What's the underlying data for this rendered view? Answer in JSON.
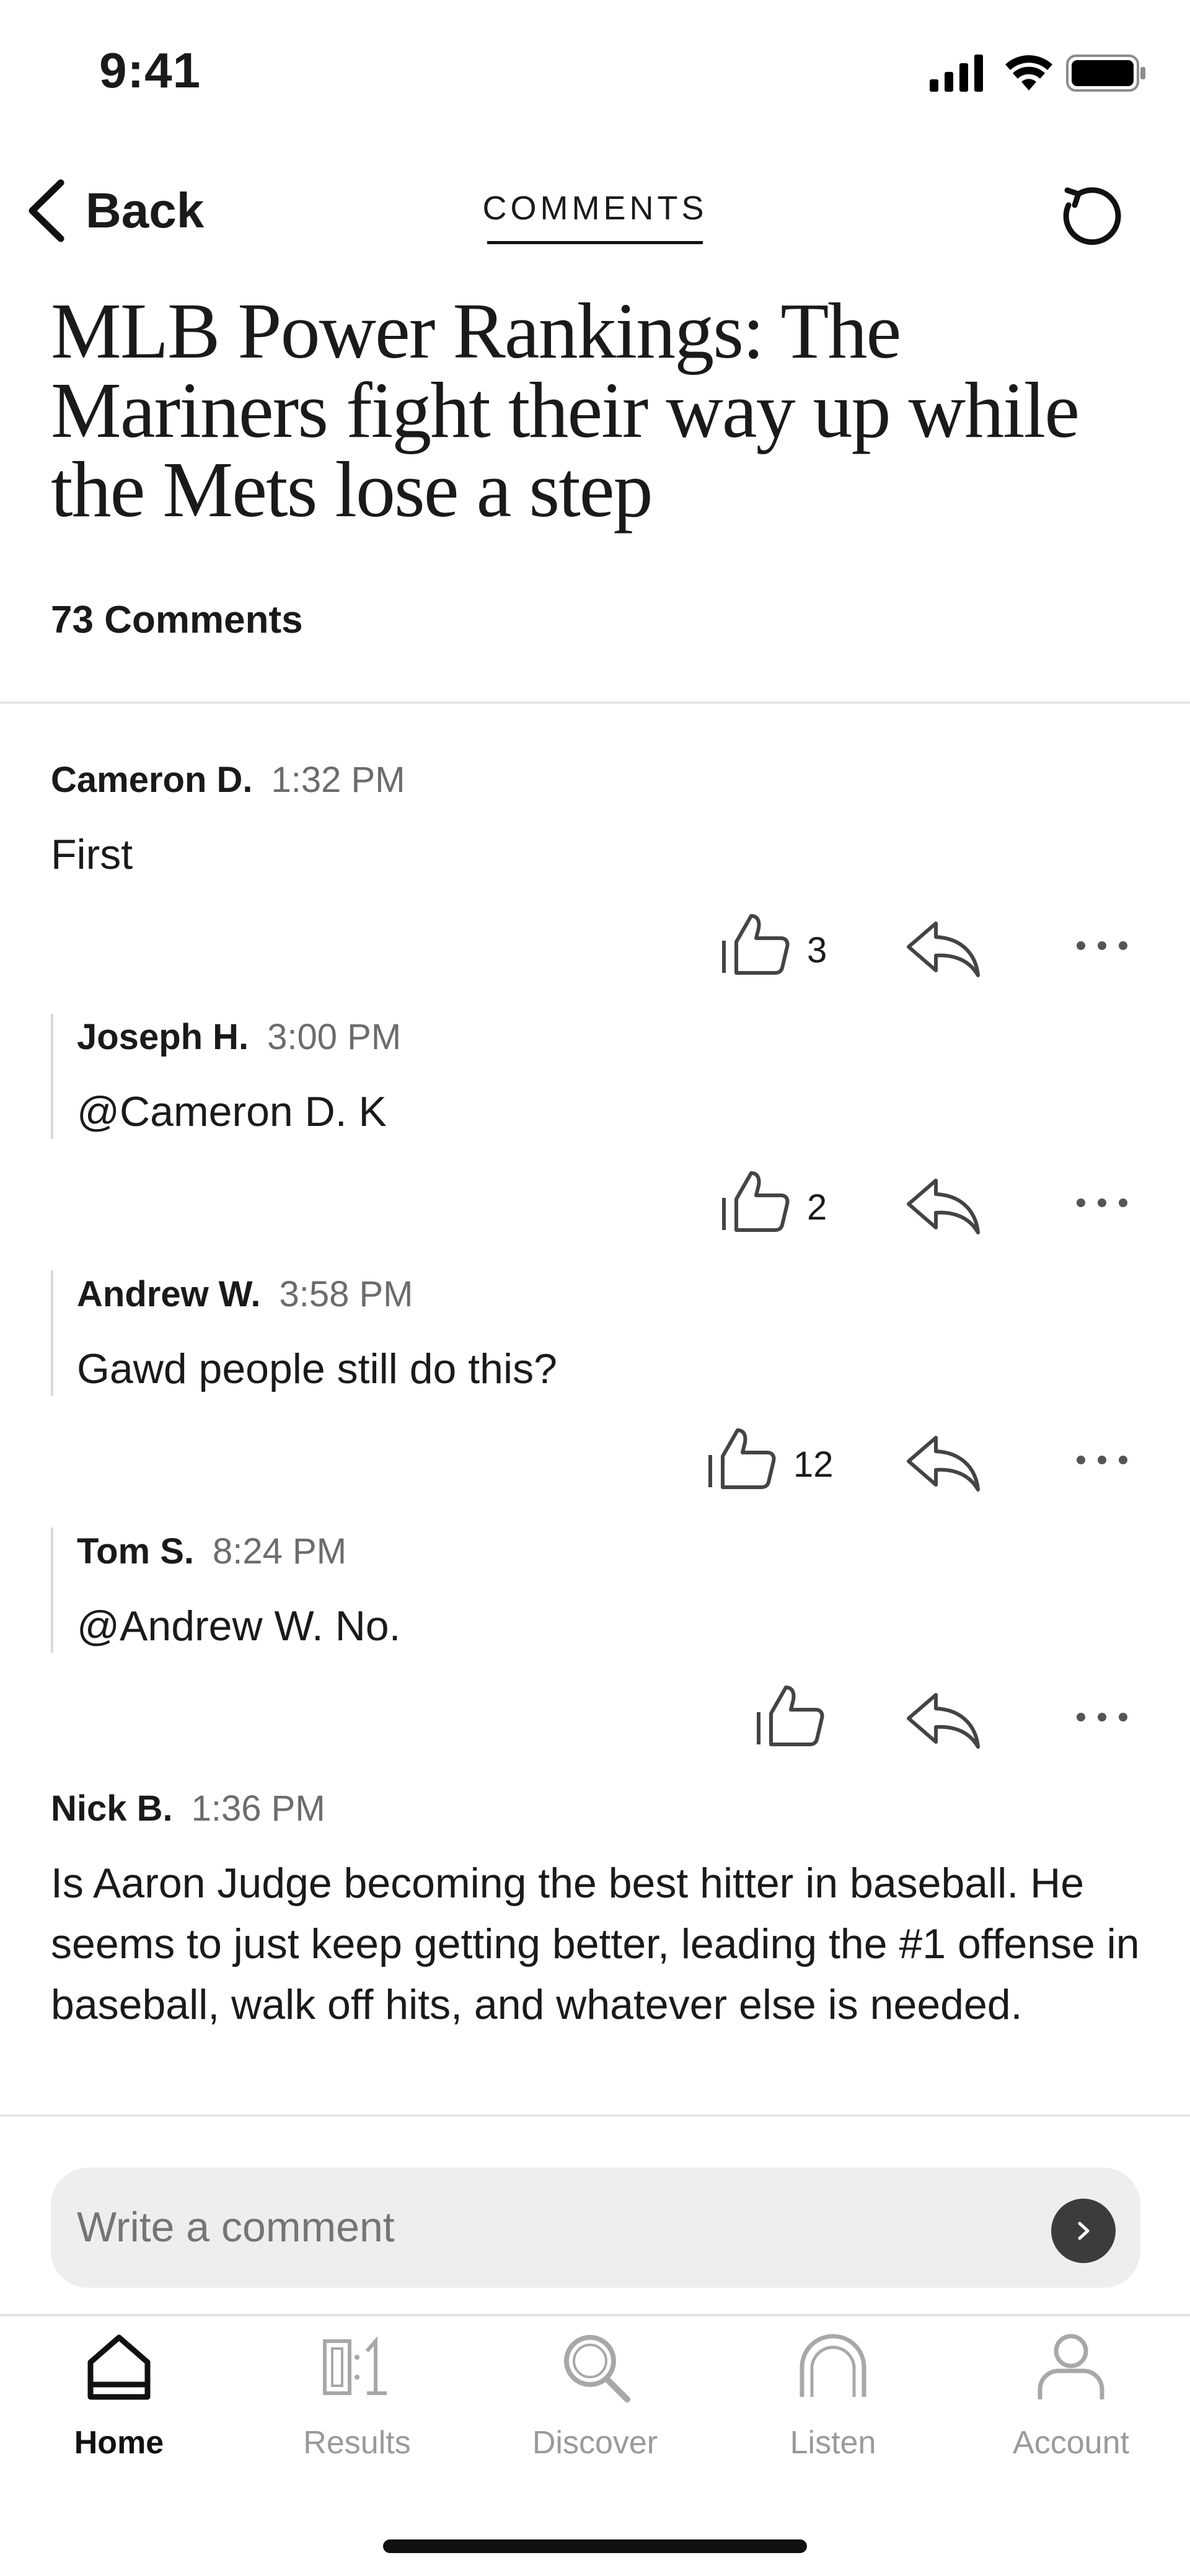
{
  "status_bar": {
    "time": "9:41"
  },
  "header": {
    "back_label": "Back",
    "tab_title": "COMMENTS"
  },
  "article": {
    "title": "MLB Power Rankings: The Mariners fight their way up while the Mets lose a step",
    "comment_count_label": "73 Comments"
  },
  "comments": [
    {
      "author": "Cameron D.",
      "time": "1:32 PM",
      "text": "First",
      "likes": "3",
      "is_reply": false
    },
    {
      "author": "Joseph H.",
      "time": "3:00 PM",
      "text": "@Cameron D. K",
      "likes": "2",
      "is_reply": true
    },
    {
      "author": "Andrew W.",
      "time": "3:58 PM",
      "text": "Gawd people still do this?",
      "likes": "12",
      "is_reply": true
    },
    {
      "author": "Tom S.",
      "time": "8:24 PM",
      "text": "@Andrew W. No.",
      "likes": "",
      "is_reply": true
    },
    {
      "author": "Nick B.",
      "time": "1:36 PM",
      "text": "Is Aaron Judge becoming the best hitter in baseball. He seems to just keep getting better, leading the #1 offense in baseball, walk off hits, and whatever else is needed.",
      "is_reply": false
    }
  ],
  "composer": {
    "placeholder": "Write a comment"
  },
  "tab_bar": {
    "items": [
      {
        "label": "Home",
        "icon": "home-icon",
        "active": true
      },
      {
        "label": "Results",
        "icon": "scoreboard-icon",
        "active": false
      },
      {
        "label": "Discover",
        "icon": "search-icon",
        "active": false
      },
      {
        "label": "Listen",
        "icon": "headphones-icon",
        "active": false
      },
      {
        "label": "Account",
        "icon": "person-icon",
        "active": false
      }
    ]
  },
  "colors": {
    "text": "#1a1a1a",
    "muted": "#6c6c6c",
    "inactive_tab": "#9a9a9a",
    "composer_bg": "#eeeeee"
  }
}
